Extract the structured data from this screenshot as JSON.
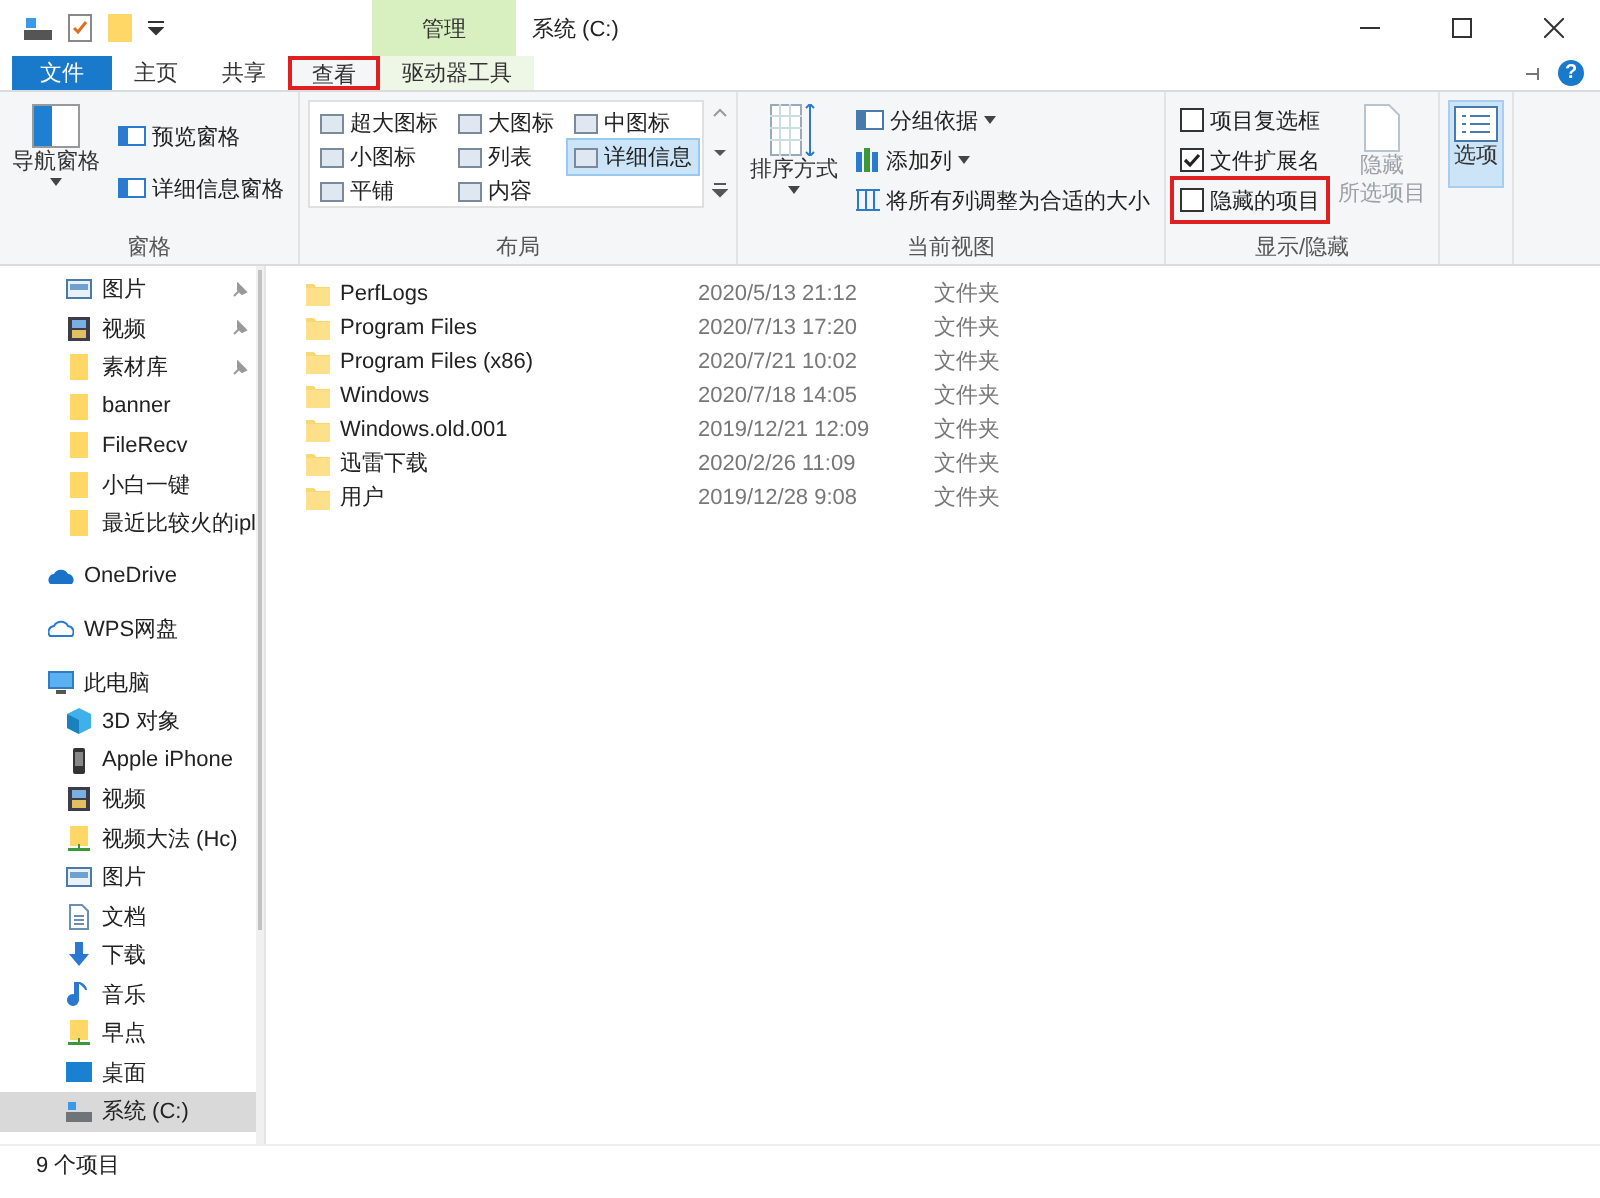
{
  "window": {
    "title": "系统 (C:)",
    "context_tab": "管理",
    "help": "?"
  },
  "tabs": [
    {
      "label": "文件",
      "kind": "file",
      "selected": false,
      "highlighted": false
    },
    {
      "label": "主页",
      "kind": "normal",
      "selected": false,
      "highlighted": false
    },
    {
      "label": "共享",
      "kind": "normal",
      "selected": false,
      "highlighted": false
    },
    {
      "label": "查看",
      "kind": "normal",
      "selected": true,
      "highlighted": true
    },
    {
      "label": "驱动器工具",
      "kind": "context",
      "selected": false,
      "highlighted": false
    }
  ],
  "ribbon": {
    "panes": {
      "label": "窗格",
      "nav": "导航窗格",
      "items": [
        "预览窗格",
        "详细信息窗格"
      ]
    },
    "layout": {
      "label": "布局",
      "options": [
        {
          "label": "超大图标",
          "selected": false
        },
        {
          "label": "大图标",
          "selected": false
        },
        {
          "label": "中图标",
          "selected": false
        },
        {
          "label": "小图标",
          "selected": false
        },
        {
          "label": "列表",
          "selected": false
        },
        {
          "label": "详细信息",
          "selected": true
        },
        {
          "label": "平铺",
          "selected": false
        },
        {
          "label": "内容",
          "selected": false
        }
      ]
    },
    "view": {
      "label": "当前视图",
      "sort": "排序方式",
      "group": "分组依据",
      "add_column": "添加列",
      "fit": "将所有列调整为合适的大小"
    },
    "show_hide": {
      "label": "显示/隐藏",
      "checkboxes": [
        {
          "label": "项目复选框",
          "checked": false,
          "highlighted": false
        },
        {
          "label": "文件扩展名",
          "checked": true,
          "highlighted": false
        },
        {
          "label": "隐藏的项目",
          "checked": false,
          "highlighted": true
        }
      ],
      "hide_selected": {
        "lines": [
          "隐藏",
          "所选项目"
        ],
        "disabled": true
      }
    },
    "options": {
      "label": "选项"
    }
  },
  "sidebar": {
    "quick_access": [
      {
        "label": "图片",
        "kind": "picture",
        "pinned": true
      },
      {
        "label": "视频",
        "kind": "video",
        "pinned": true
      },
      {
        "label": "素材库",
        "kind": "folder",
        "pinned": true
      },
      {
        "label": "banner",
        "kind": "folder",
        "pinned": false
      },
      {
        "label": "FileRecv",
        "kind": "folder",
        "pinned": false
      },
      {
        "label": "小白一键",
        "kind": "folder",
        "pinned": false
      },
      {
        "label": "最近比较火的ipl",
        "kind": "folder",
        "pinned": false
      }
    ],
    "items": [
      {
        "label": "OneDrive",
        "kind": "cloud",
        "selected": false
      },
      {
        "label": "WPS网盘",
        "kind": "outline",
        "selected": false
      },
      {
        "label": "此电脑",
        "kind": "pc",
        "selected": false,
        "children": [
          {
            "label": "3D 对象",
            "kind": "cube",
            "selected": false
          },
          {
            "label": "Apple iPhone",
            "kind": "phone",
            "selected": false
          },
          {
            "label": "视频",
            "kind": "video",
            "selected": false
          },
          {
            "label": "视频大法 (Hc)",
            "kind": "netfolder",
            "selected": false
          },
          {
            "label": "图片",
            "kind": "picture",
            "selected": false
          },
          {
            "label": "文档",
            "kind": "document",
            "selected": false
          },
          {
            "label": "下载",
            "kind": "download",
            "selected": false
          },
          {
            "label": "音乐",
            "kind": "music",
            "selected": false
          },
          {
            "label": "早点",
            "kind": "netfolder",
            "selected": false
          },
          {
            "label": "桌面",
            "kind": "desktop",
            "selected": false
          },
          {
            "label": "系统 (C:)",
            "kind": "drive",
            "selected": true
          }
        ]
      }
    ]
  },
  "files": [
    {
      "name": "PerfLogs",
      "date": "2020/5/13 21:12",
      "type": "文件夹"
    },
    {
      "name": "Program Files",
      "date": "2020/7/13 17:20",
      "type": "文件夹"
    },
    {
      "name": "Program Files (x86)",
      "date": "2020/7/21 10:02",
      "type": "文件夹"
    },
    {
      "name": "Windows",
      "date": "2020/7/18 14:05",
      "type": "文件夹"
    },
    {
      "name": "Windows.old.001",
      "date": "2019/12/21 12:09",
      "type": "文件夹"
    },
    {
      "name": "迅雷下载",
      "date": "2020/2/26 11:09",
      "type": "文件夹"
    },
    {
      "name": "用户",
      "date": "2019/12/28 9:08",
      "type": "文件夹"
    }
  ],
  "status_bar": {
    "count": "9 个项目"
  }
}
